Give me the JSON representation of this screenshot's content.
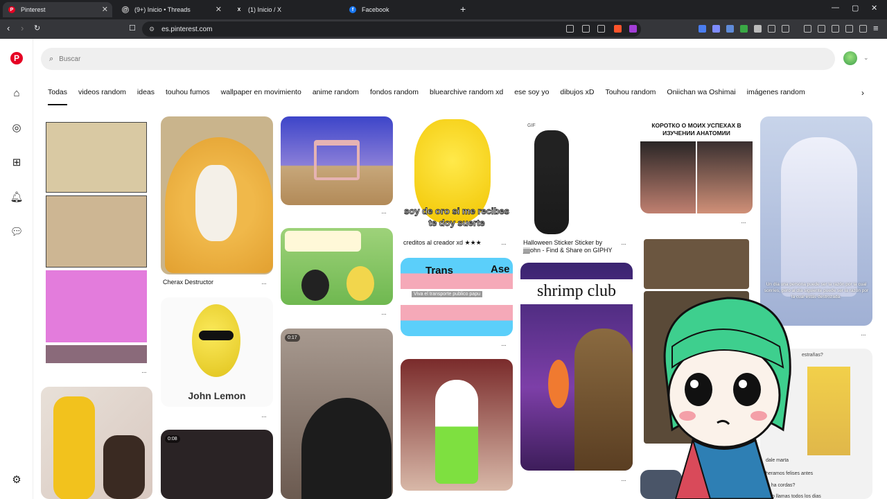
{
  "browser": {
    "tabs": [
      {
        "label": "Pinterest",
        "icon": "pinterest-icon"
      },
      {
        "label": "(9+) Inicio • Threads",
        "icon": "threads-icon"
      },
      {
        "label": "(1) Inicio / X",
        "icon": "x-icon"
      },
      {
        "label": "Facebook",
        "icon": "facebook-icon"
      }
    ],
    "url": "es.pinterest.com"
  },
  "header": {
    "search_placeholder": "Buscar"
  },
  "chips": [
    "Todas",
    "videos random",
    "ideas",
    "touhou fumos",
    "wallpaper en movimiento",
    "anime random",
    "fondos random",
    "bluearchive random xd",
    "ese soy yo",
    "dibujos xD",
    "Touhou random",
    "Oniichan wa Oshimai",
    "imágenes random"
  ],
  "pins": {
    "crayfish_caption": "Cherax Destructor",
    "lemon_text": "John Lemon",
    "dog_text": "soy de oro si me recibes te doy suerte",
    "dog_caption": "creditos al creador xd ★★★",
    "halloween_caption": "Halloween Sticker Sticker by jjjjjohn - Find & Share on GIPHY",
    "gif_badge": "GIF",
    "trans_text": "Trans",
    "trans_ase": "Ase",
    "trans_sub": "Viva el transporte publico papu",
    "shrimp_text": "shrimp club",
    "russian_text": "КОРОТКО О МОИХ УСПЕХАХ В ИЗУЧЕНИИ АНАТОМИИ",
    "cat_duration": "0:17",
    "dark_duration": "0:08",
    "anime_text": "Un día una persona puede ser la razón por la cual sonríes, pero al día siguiente puede ser la razón por la cual estás destrozada.",
    "chat_1": "dale marta",
    "chat_2": "heramos felises antes",
    "chat_3": "te ha cordas?",
    "chat_4": "y yo llamas todos los dias",
    "chat_top": "estrañas?"
  },
  "colors": {
    "brand": "#e60023",
    "topbar": "#202124"
  }
}
